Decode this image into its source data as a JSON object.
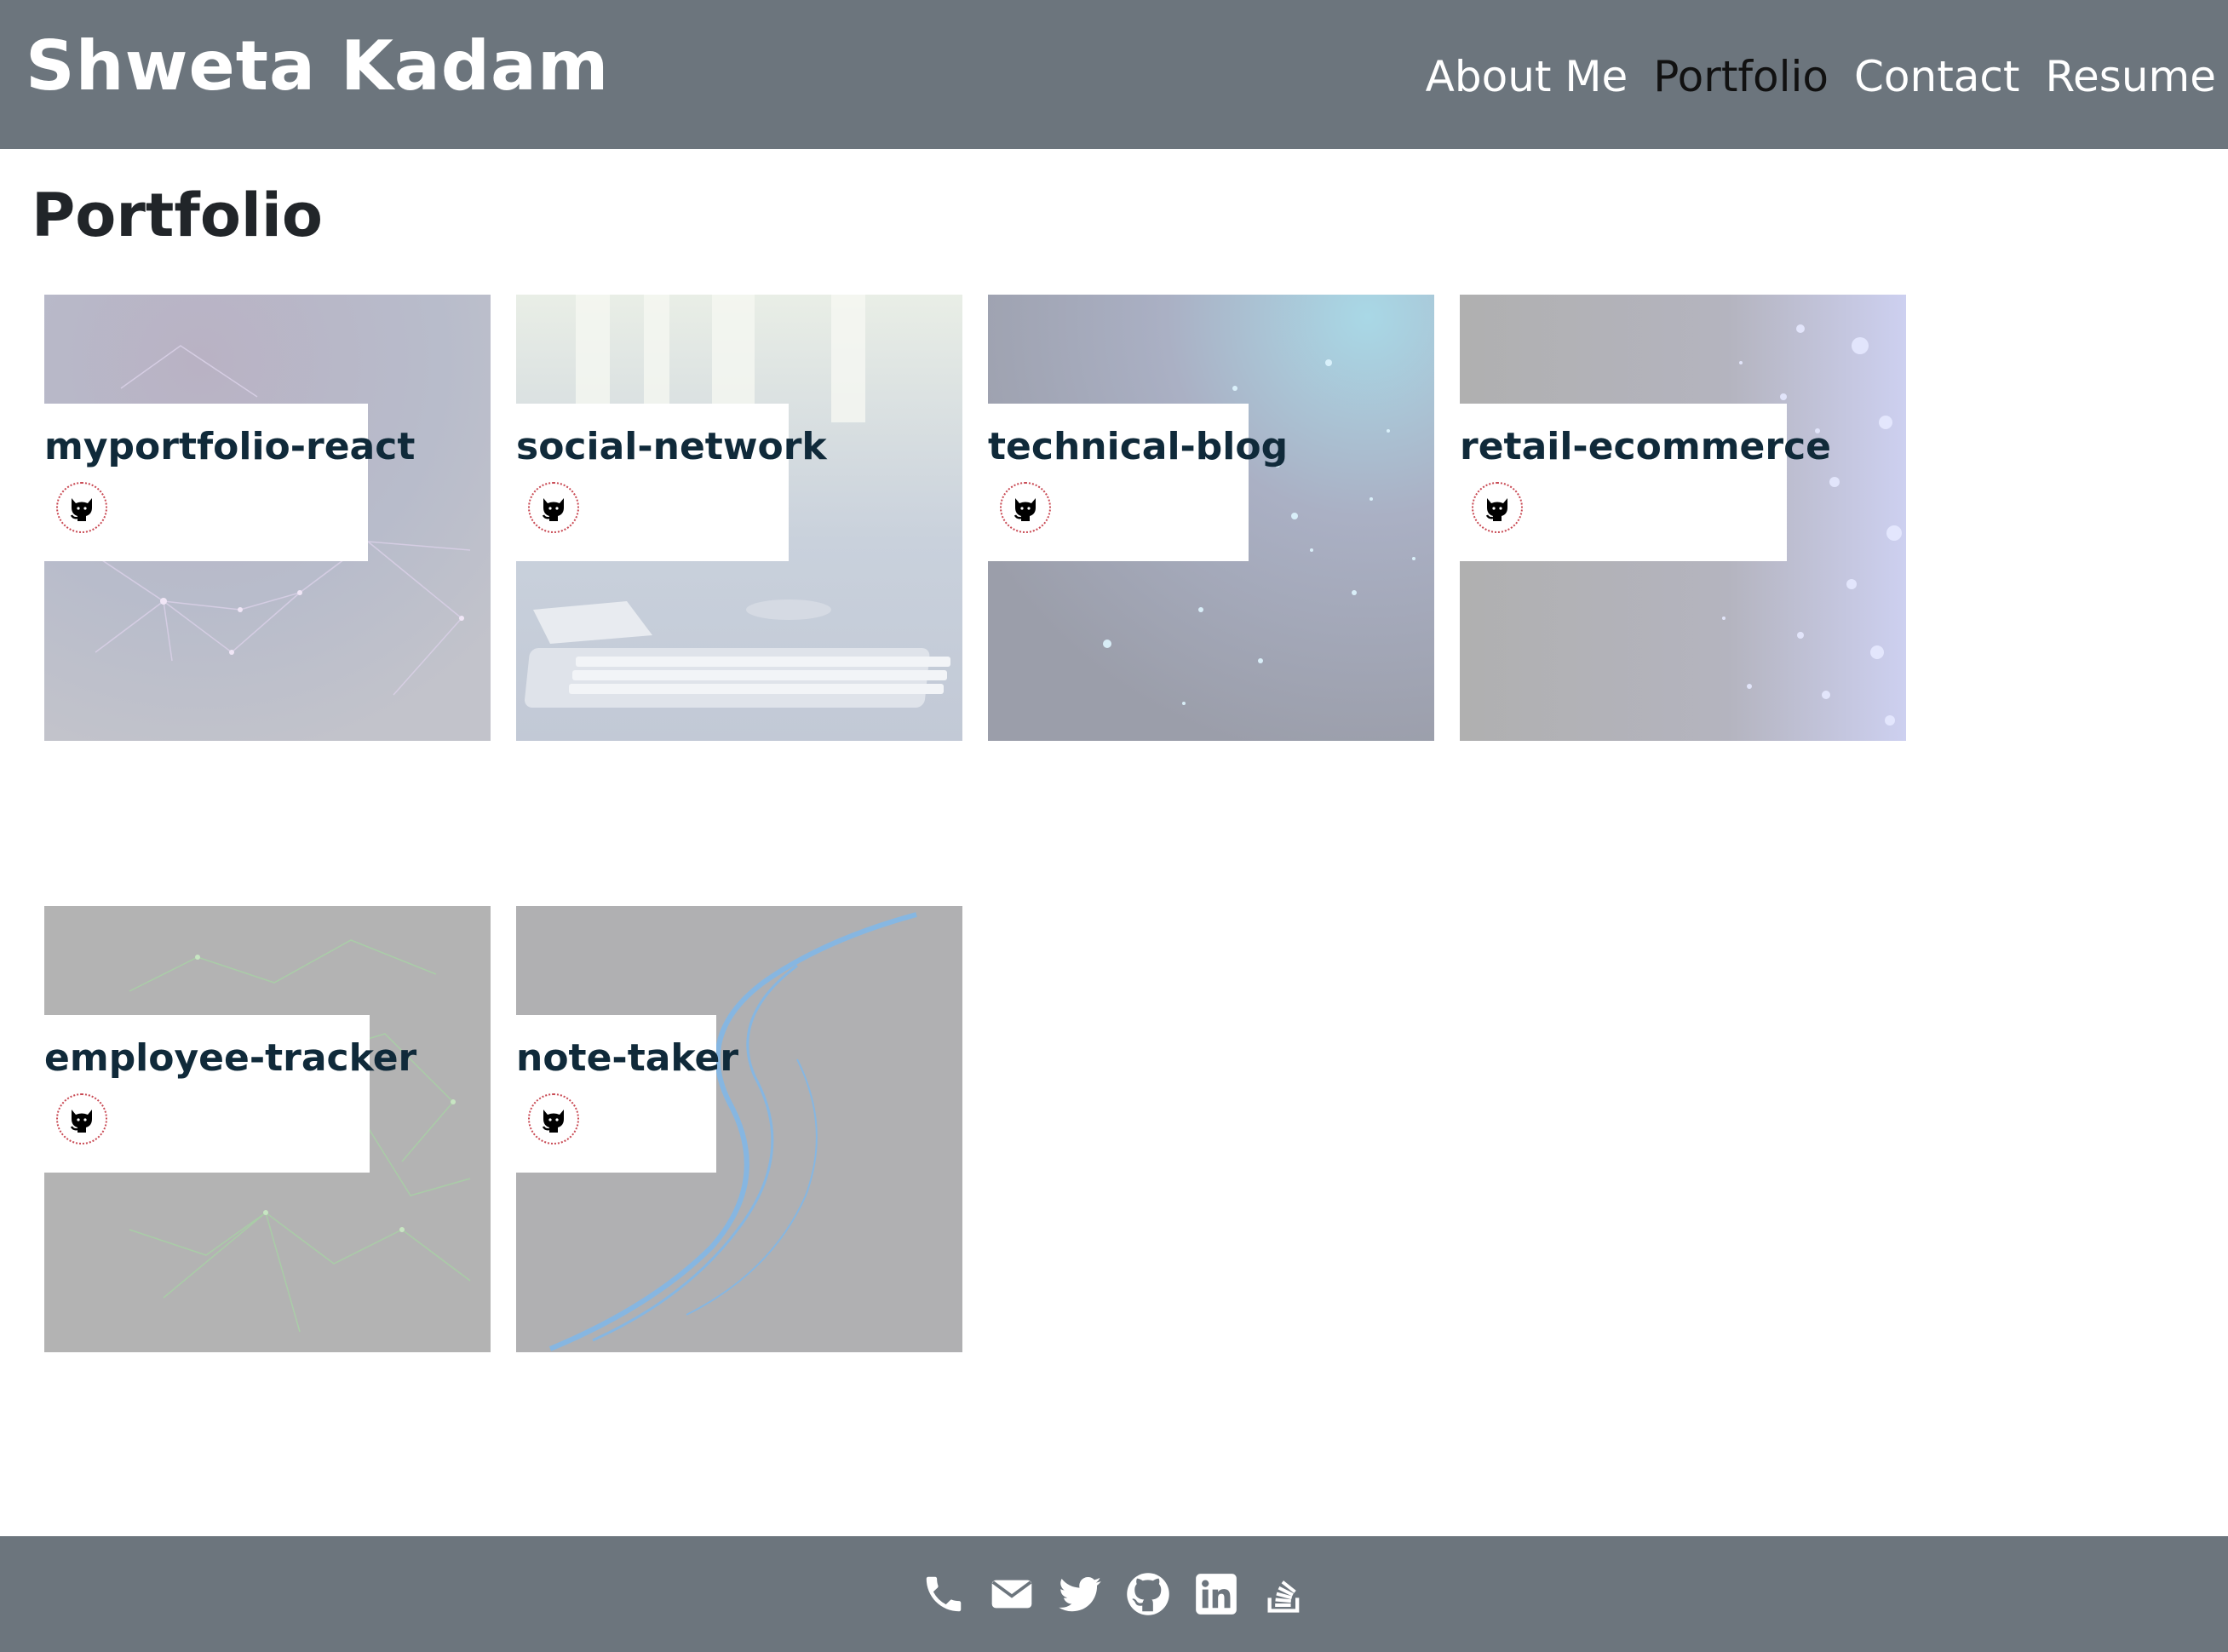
{
  "header": {
    "brand": "Shweta Kadam",
    "nav": [
      {
        "label": "About Me",
        "active": false
      },
      {
        "label": "Portfolio",
        "active": true
      },
      {
        "label": "Contact",
        "active": false
      },
      {
        "label": "Resume",
        "active": false
      }
    ]
  },
  "main": {
    "title": "Portfolio",
    "projects": [
      {
        "name": "myportfolio-react",
        "icon": "github-icon"
      },
      {
        "name": "social-network",
        "icon": "github-icon"
      },
      {
        "name": "technical-blog",
        "icon": "github-icon"
      },
      {
        "name": "retail-ecommerce",
        "icon": "github-icon"
      },
      {
        "name": "employee-tracker",
        "icon": "github-icon"
      },
      {
        "name": "note-taker",
        "icon": "github-icon"
      }
    ]
  },
  "footer": {
    "icons": [
      "phone-icon",
      "email-icon",
      "twitter-icon",
      "github-icon",
      "linkedin-icon",
      "stackoverflow-icon"
    ]
  },
  "colors": {
    "header_bg": "#6c757d",
    "footer_bg": "#6c757d",
    "active_nav": "#111111",
    "card_title": "#102a3a",
    "icon_ring": "#c94a54"
  }
}
